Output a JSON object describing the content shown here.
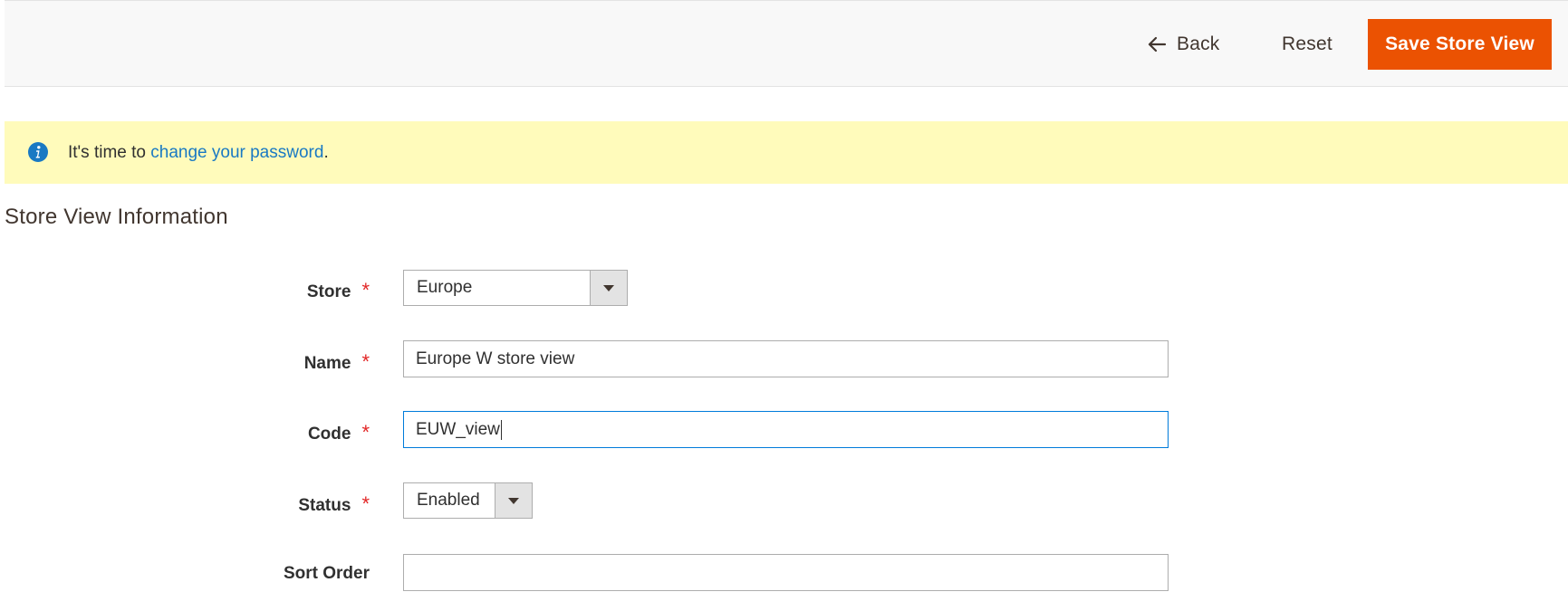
{
  "toolbar": {
    "back_label": "Back",
    "reset_label": "Reset",
    "save_label": "Save Store View",
    "back_icon": "arrow-left-icon"
  },
  "notice": {
    "icon": "info-icon",
    "prefix": "It's time to ",
    "link": "change your password",
    "suffix": "."
  },
  "section": {
    "title": "Store View Information"
  },
  "form": {
    "store": {
      "label": "Store",
      "value": "Europe",
      "required": true
    },
    "name": {
      "label": "Name",
      "value": "Europe W store view",
      "required": true
    },
    "code": {
      "label": "Code",
      "value": "EUW_view",
      "required": true
    },
    "status": {
      "label": "Status",
      "value": "Enabled",
      "required": true
    },
    "sort_order": {
      "label": "Sort Order",
      "value": "",
      "required": false
    },
    "required_marker": "*"
  },
  "colors": {
    "primary_button": "#eb5202",
    "link": "#1979c3",
    "notice_bg": "#fffbbb",
    "required": "#e22626",
    "focus_border": "#007bdb"
  }
}
